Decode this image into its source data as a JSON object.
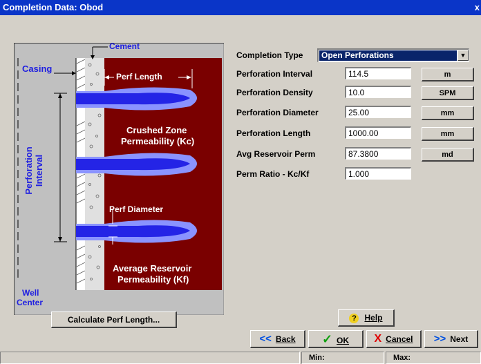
{
  "window": {
    "title": "Completion Data: Obod",
    "close_glyph": "x"
  },
  "diagram": {
    "labels": {
      "cement": "Cement",
      "casing": "Casing",
      "perf_length": "Perf Length",
      "crushed_zone_1": "Crushed Zone",
      "crushed_zone_2": "Permeability (Kc)",
      "perforation_interval": "Perforation Interval",
      "perf_diameter": "Perf Diameter",
      "avg_res_1": "Average Reservoir",
      "avg_res_2": "Permeability (Kf)",
      "well": "Well",
      "center": "Center"
    },
    "colors": {
      "formation": "#7a0000",
      "perforation": "#2424e6",
      "crushed": "#8a93ff",
      "cement": "#d8d8d8",
      "label_blue": "#2020e0"
    }
  },
  "form": {
    "completion_type": {
      "label": "Completion Type",
      "value": "Open Perforations"
    },
    "fields": [
      {
        "label": "Perforation Interval",
        "value": "114.5",
        "unit": "m"
      },
      {
        "label": "Perforation Density",
        "value": "10.0",
        "unit": "SPM"
      },
      {
        "label": "Perforation Diameter",
        "value": "25.00",
        "unit": "mm"
      },
      {
        "label": "Perforation Length",
        "value": "1000.00",
        "unit": "mm"
      },
      {
        "label": "Avg Reservoir Perm",
        "value": "87.3800",
        "unit": "md"
      },
      {
        "label": "Perm Ratio - Kc/Kf",
        "value": "1.000"
      }
    ]
  },
  "buttons": {
    "calculate": "Calculate Perf Length...",
    "help": "Help",
    "back": "Back",
    "ok": "OK",
    "cancel": "Cancel",
    "next": "Next",
    "back_icon": "<<",
    "next_icon": ">>",
    "ok_icon": "✓",
    "cancel_icon": "X",
    "help_icon": "?"
  },
  "status": {
    "min_label": "Min:",
    "max_label": "Max:"
  }
}
